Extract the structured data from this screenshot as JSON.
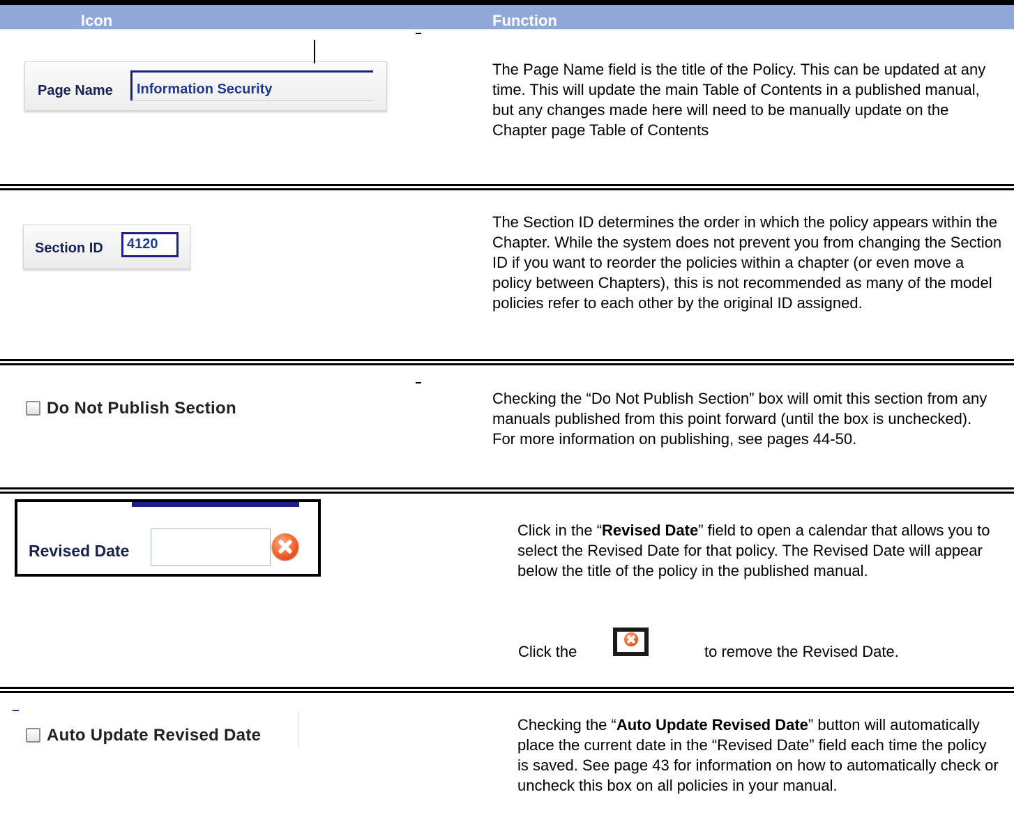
{
  "header": {
    "col_icon": "Icon",
    "col_function": "Function",
    "bg_color": "#8fa8d8"
  },
  "rows": [
    {
      "widget": {
        "label": "Page Name",
        "value": "Information Security"
      },
      "description": "The Page Name field is the title of the Policy.  This can be updated at any time.  This will update the main Table of Contents in a published manual, but any changes made here will need to be manually update on the Chapter page Table of Contents"
    },
    {
      "widget": {
        "label": "Section ID",
        "value": "4120"
      },
      "description": "The Section ID determines the order in which the policy appears within the Chapter.  While the system does not prevent you from changing the Section ID if you want to reorder the policies within a chapter (or even move a policy between Chapters), this is not recommended as many of the model policies refer to each other by the original ID assigned."
    },
    {
      "widget": {
        "label": "Do Not Publish Section",
        "checked": false
      },
      "description": "Checking the “Do Not Publish Section” box will omit this section from any manuals published from this point forward (until the box is unchecked). For more information on publishing, see pages 44-50."
    },
    {
      "widget": {
        "label": "Revised Date",
        "value": "",
        "clear_icon": "clear-x-circle-icon"
      },
      "description": {
        "pre": "Click in the “",
        "bold": "Revised Date",
        "post": "” field to open a calendar that allows you to select the Revised Date for that policy.  The Revised Date will appear below the title of the policy in the published manual."
      },
      "inline_note": {
        "before": "Click the",
        "after": "to remove the Revised Date.",
        "icon": "clear-x-circle-icon"
      }
    },
    {
      "widget": {
        "label": "Auto Update Revised Date",
        "checked": false
      },
      "description": {
        "pre": "Checking  the “",
        "bold": "Auto Update Revised Date",
        "post": "” button will automatically place the current date in the “Revised Date” field  each time the policy is saved.  See page 43 for information on how to automatically check or uncheck this box on all policies in your manual."
      }
    }
  ]
}
